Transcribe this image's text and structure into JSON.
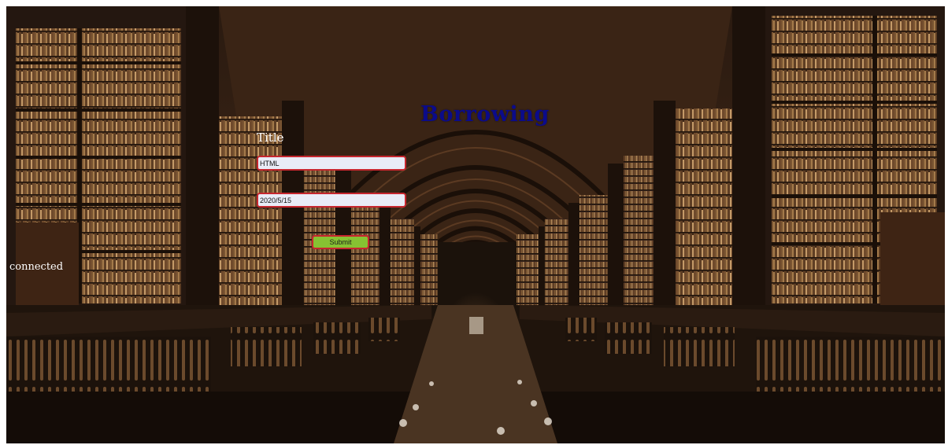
{
  "page": {
    "heading": "Borrowing"
  },
  "form": {
    "title_label": "Title",
    "title_value": "HTML",
    "date_value": "2020/5/15",
    "submit_label": "Submit"
  },
  "status": {
    "text": "connected"
  },
  "colors": {
    "heading": "#0b0b8a",
    "field_border": "#c6262e",
    "field_background": "#e9ecf7",
    "button_background": "#86c232"
  }
}
